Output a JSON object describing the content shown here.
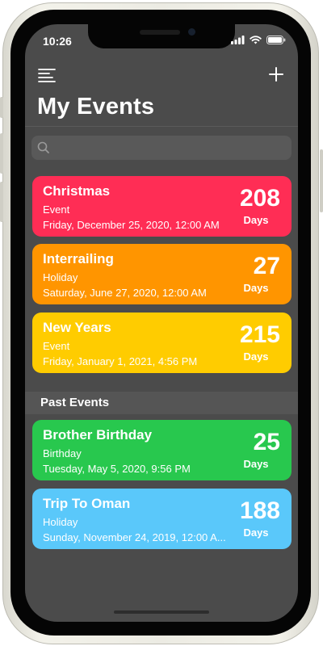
{
  "status_bar": {
    "time": "10:26"
  },
  "header": {
    "title": "My Events"
  },
  "search": {
    "placeholder": ""
  },
  "upcoming": [
    {
      "title": "Christmas",
      "type": "Event",
      "date": "Friday, December 25, 2020, 12:00 AM",
      "count": "208",
      "unit": "Days",
      "color": "#FF2D55"
    },
    {
      "title": "Interrailing",
      "type": "Holiday",
      "date": "Saturday, June 27, 2020, 12:00 AM",
      "count": "27",
      "unit": "Days",
      "color": "#FF9500"
    },
    {
      "title": "New Years",
      "type": "Event",
      "date": "Friday, January 1, 2021, 4:56 PM",
      "count": "215",
      "unit": "Days",
      "color": "#FFCC00"
    }
  ],
  "past_section": {
    "label": "Past Events"
  },
  "past": [
    {
      "title": "Brother Birthday",
      "type": "Birthday",
      "date": "Tuesday, May 5, 2020, 9:56 PM",
      "count": "25",
      "unit": "Days",
      "color": "#28C84E"
    },
    {
      "title": "Trip To Oman",
      "type": "Holiday",
      "date": "Sunday, November 24, 2019, 12:00 A...",
      "count": "188",
      "unit": "Days",
      "color": "#5AC8FA"
    }
  ]
}
